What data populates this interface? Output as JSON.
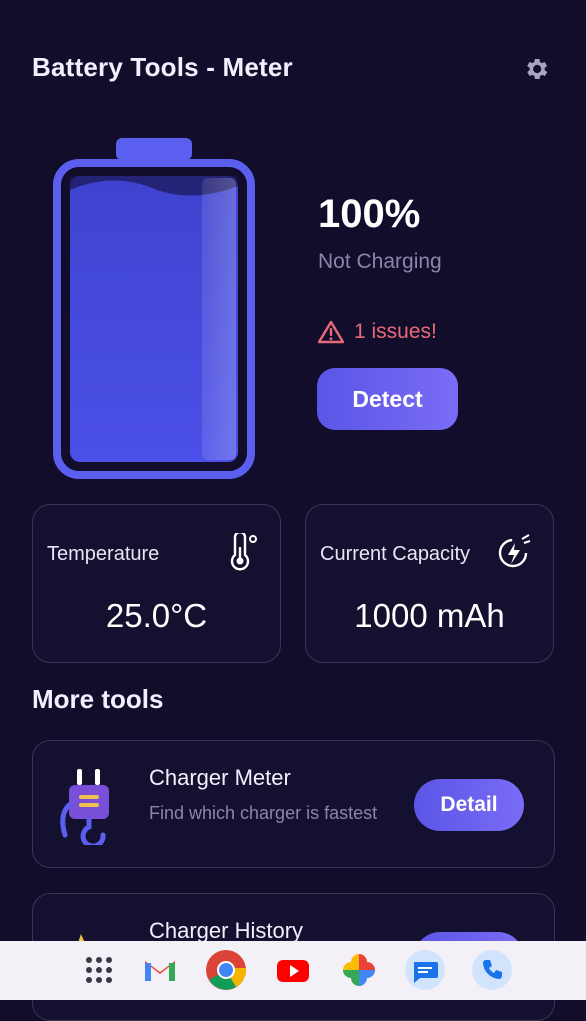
{
  "app": {
    "title": "Battery Tools - Meter"
  },
  "battery": {
    "level_percent": 100,
    "percent_label": "100%",
    "status": "Not Charging",
    "issues_label": "1 issues!",
    "detect_label": "Detect"
  },
  "stats": [
    {
      "label": "Temperature",
      "value": "25.0°C",
      "icon": "thermometer-icon"
    },
    {
      "label": "Current Capacity",
      "value": "1000 mAh",
      "icon": "capacity-gauge-icon"
    }
  ],
  "more_tools": {
    "heading": "More tools",
    "items": [
      {
        "title": "Charger Meter",
        "description": "Find which charger is fastest",
        "button": "Detail",
        "icon": "charger-plug-icon"
      },
      {
        "title": "Charger History",
        "description": "",
        "button": "",
        "icon": "history-icon"
      }
    ]
  },
  "dock": {
    "apps": [
      "app-drawer-icon",
      "gmail-icon",
      "chrome-icon",
      "youtube-icon",
      "photos-icon",
      "messages-icon",
      "phone-icon"
    ]
  },
  "colors": {
    "background": "#110d2b",
    "accent": "#5b55e6",
    "battery_fill": "#4b50e8",
    "warning": "#e86a78",
    "muted_text": "#8a86a8"
  }
}
